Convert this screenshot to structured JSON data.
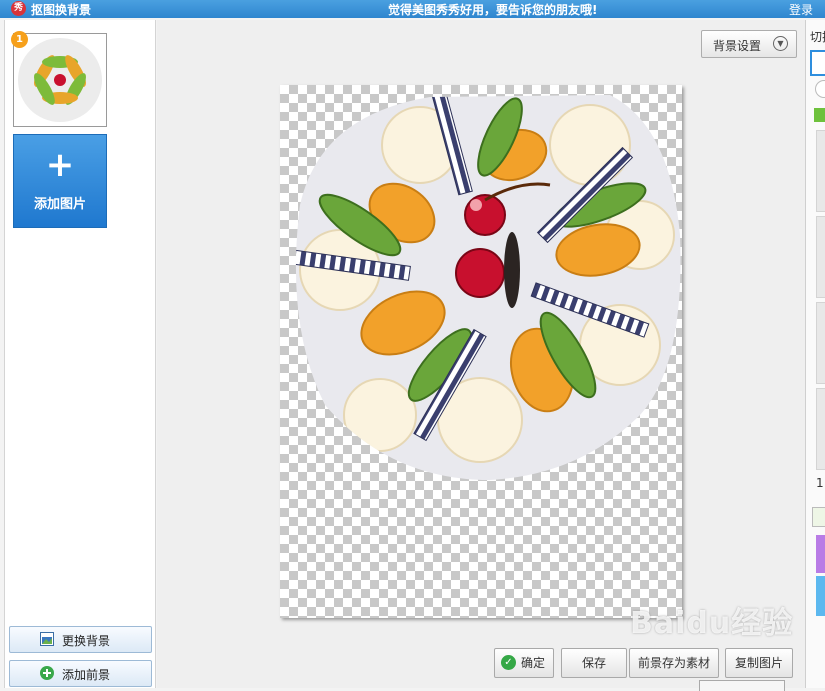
{
  "titlebar": {
    "app_icon": "秀",
    "title": "抠图换背景",
    "promo": "觉得美图秀秀好用，要告诉您的朋友哦!",
    "login": "登录"
  },
  "left_panel": {
    "thumbnail": {
      "badge": "1",
      "icon": "cake-thumbnail"
    },
    "add_image": {
      "icon": "plus-icon",
      "label": "添加图片"
    },
    "change_background": {
      "icon": "image-swap-icon",
      "label": "更换背景"
    },
    "add_foreground": {
      "icon": "green-plus-icon",
      "label": "添加前景"
    }
  },
  "main": {
    "bg_settings": {
      "label": "背景设置",
      "icon": "chevron-down-icon"
    },
    "canvas": {
      "content": "cake-cutout-on-transparent-checkerboard"
    }
  },
  "buttons": {
    "confirm": "确定",
    "save": "保存",
    "save_as_material": "前景存为素材",
    "copy_image": "复制图片"
  },
  "right_panel": {
    "cut_label": "切换",
    "number": "1"
  },
  "watermark": "Baidu经验",
  "colors": {
    "titlebar": "#2f86cf",
    "accent_blue": "#1f78cf",
    "confirm_green": "#35a846"
  }
}
